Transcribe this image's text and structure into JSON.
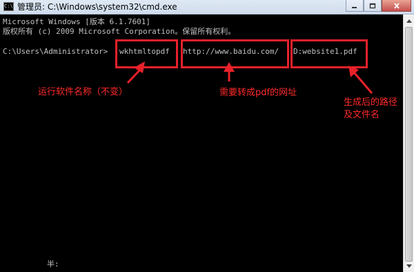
{
  "window": {
    "title": "管理员: C:\\Windows\\system32\\cmd.exe",
    "icon": "cmd-icon"
  },
  "console": {
    "line1": "Microsoft Windows [版本 6.1.7601]",
    "line2": "版权所有 (c) 2009 Microsoft Corporation。保留所有权利。",
    "prompt": "C:\\Users\\Administrator>",
    "command": "wkhtmltopdf",
    "url": "http://www.baidu.com/",
    "output_file": "D:website1.pdf",
    "ime_status": "半:"
  },
  "annotations": {
    "software_name": "运行软件名称（不变）",
    "url_note": "需要转成pdf的网址",
    "path_note_line1": "生成后的路径",
    "path_note_line2": "及文件名"
  },
  "colors": {
    "annotation_red": "#e8212a",
    "console_bg": "#000000",
    "console_text": "#c0c0c0"
  }
}
